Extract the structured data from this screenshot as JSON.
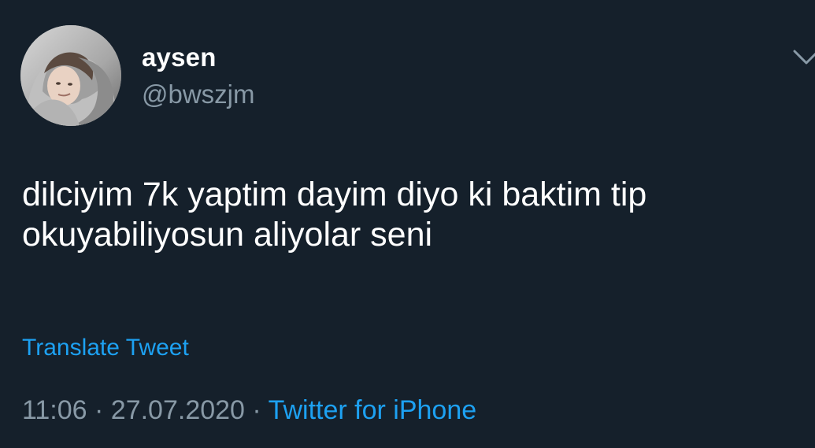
{
  "tweet": {
    "author": {
      "name": "aysen",
      "handle": "@bwszjm"
    },
    "text": "dilciyim 7k yaptim dayim diyo ki baktim tip okuyabiliyosun aliyolar seni",
    "translate_label": "Translate Tweet",
    "meta": {
      "time": "11:06",
      "separator": "·",
      "date": "27.07.2020",
      "source": "Twitter for iPhone"
    }
  },
  "colors": {
    "background": "#15202b",
    "primary_text": "#ffffff",
    "secondary_text": "#8899a6",
    "link": "#1da1f2"
  },
  "icons": {
    "avatar": "profile-photo",
    "menu": "chevron-down-icon"
  }
}
